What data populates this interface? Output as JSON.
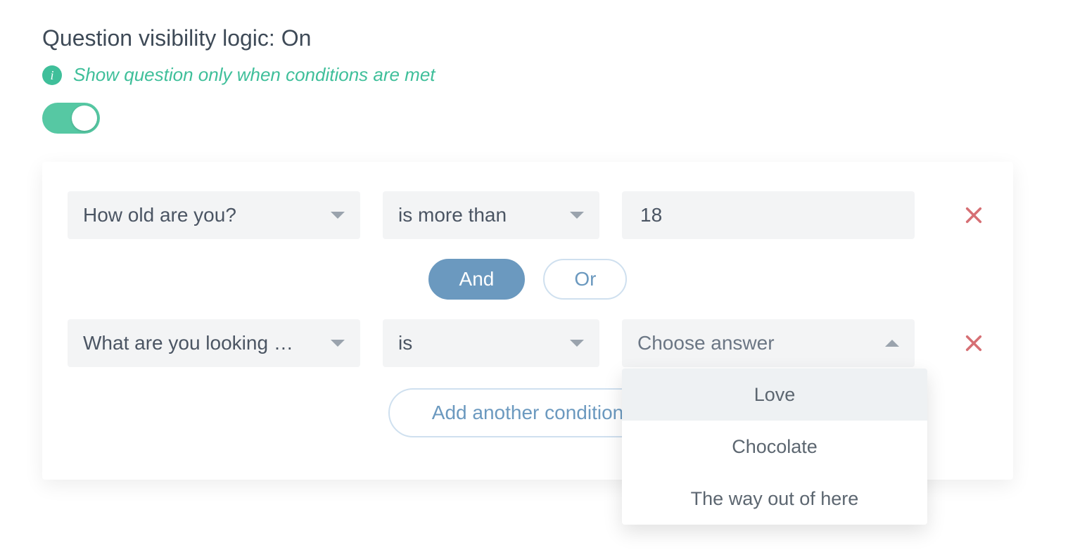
{
  "title": "Question visibility logic: On",
  "info_text": "Show question only when conditions are met",
  "toggle_on": true,
  "conjunction": {
    "and_label": "And",
    "or_label": "Or",
    "selected": "and"
  },
  "add_condition_label": "Add another condition",
  "conditions": [
    {
      "question": "How old are you?",
      "operator": "is more than",
      "value": "18",
      "value_is_input": true
    },
    {
      "question": "What are you looking …",
      "operator": "is",
      "answer_placeholder": "Choose answer",
      "answer_open": true,
      "answer_options": [
        "Love",
        "Chocolate",
        "The way out of here"
      ],
      "highlighted_option_index": 0
    }
  ],
  "icons": {
    "remove": "close-icon",
    "info": "info-icon",
    "caret_down": "chevron-down-icon",
    "caret_up": "chevron-up-icon"
  },
  "colors": {
    "accent_green": "#3fbf9a",
    "accent_blue": "#6b99bf",
    "field_bg": "#f3f4f5",
    "remove_red": "#d66f74"
  }
}
